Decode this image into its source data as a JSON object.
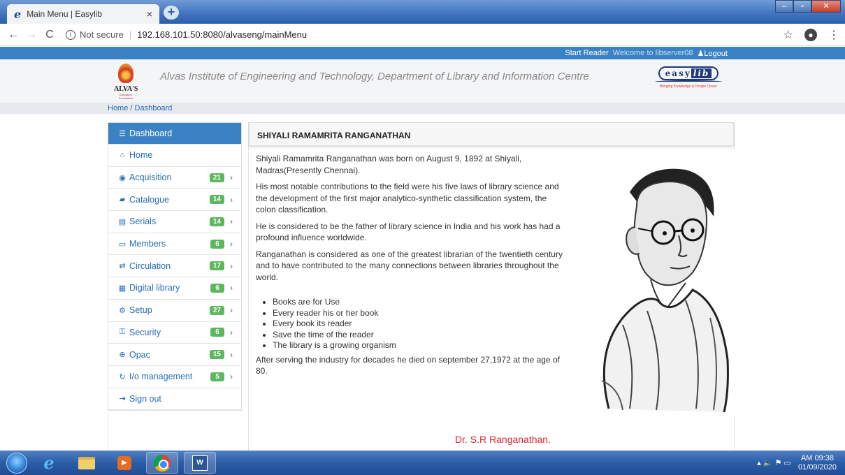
{
  "browser": {
    "tab_title": "Main Menu | Easylib",
    "tab_close": "×",
    "new_tab": "+",
    "favicon": "e",
    "security_label": "Not secure",
    "url": "192.168.101.50:8080/alvaseng/mainMenu",
    "back": "←",
    "forward": "→",
    "reload": "C",
    "info": "i",
    "star": "☆",
    "account": "⊖",
    "menu": "⋮",
    "min": "–",
    "max": "▫",
    "close": "✕"
  },
  "topbar": {
    "start_reader": "Start Reader",
    "welcome": "Welcome to libserver08",
    "logout": "♟Logout"
  },
  "header": {
    "logo_name": "ALVA'S",
    "logo_tagline": "Education Foundation",
    "institute": "Alvas Institute of Engineering and Technology, Department of Library and Information Centre",
    "easylib_easy": "easy",
    "easylib_lib": "lib",
    "easylib_tagline": "Bringing Knowledge & People Closer"
  },
  "breadcrumb": {
    "home": "Home",
    "sep": " / ",
    "current": "Dashboard"
  },
  "sidebar": {
    "items": [
      {
        "label": "Dashboard",
        "icon": "☰",
        "badge": "",
        "chev": ""
      },
      {
        "label": "Home",
        "icon": "⌂",
        "badge": "",
        "chev": ""
      },
      {
        "label": "Acquisition",
        "icon": "◉",
        "badge": "21",
        "chev": "›"
      },
      {
        "label": "Catalogue",
        "icon": "▰",
        "badge": "14",
        "chev": "›"
      },
      {
        "label": "Serials",
        "icon": "▤",
        "badge": "14",
        "chev": "›"
      },
      {
        "label": "Members",
        "icon": "▭",
        "badge": "6",
        "chev": "›"
      },
      {
        "label": "Circulation",
        "icon": "⇄",
        "badge": "17",
        "chev": "›"
      },
      {
        "label": "Digital library",
        "icon": "▦",
        "badge": "6",
        "chev": "›"
      },
      {
        "label": "Setup",
        "icon": "⚙",
        "badge": "27",
        "chev": "›"
      },
      {
        "label": "Security",
        "icon": "⚿",
        "badge": "6",
        "chev": "›"
      },
      {
        "label": "Opac",
        "icon": "⊕",
        "badge": "15",
        "chev": "›"
      },
      {
        "label": "I/o management",
        "icon": "↻",
        "badge": "5",
        "chev": "›"
      },
      {
        "label": "Sign out",
        "icon": "⇥",
        "badge": "",
        "chev": ""
      }
    ]
  },
  "content": {
    "heading": "SHIYALI RAMAMRITA RANGANATHAN",
    "paragraphs": [
      "Shiyali Ramamrita Ranganathan was born on August 9, 1892 at Shiyali, Madras(Presently Chennai).",
      "His most notable contributions to the field were his five laws of library science and the development of the first major analytico-synthetic classification system, the colon classification.",
      "He is considered to be the father of library science in India and his work has had a profound influence worldwide.",
      "Ranganathan is considered as one of the greatest librarian of the twentieth century and to have contributed to the many connections between libraries throughout the world."
    ],
    "laws": [
      "Books are for Use",
      "Every reader his or her book",
      "Every book its reader",
      "Save the time of the reader",
      "The library is a growing organism"
    ],
    "closing": "After serving the industry for decades he died on september 27,1972 at the age of 80.",
    "caption": "Dr. S.R Ranganathan."
  },
  "taskbar": {
    "ie_glyph": "e",
    "media_glyph": "▶",
    "word_glyph": "W",
    "tray_icons": "▴  🔈  ⚑  ▭",
    "time": "AM 09:38",
    "date": "01/09/2020"
  }
}
